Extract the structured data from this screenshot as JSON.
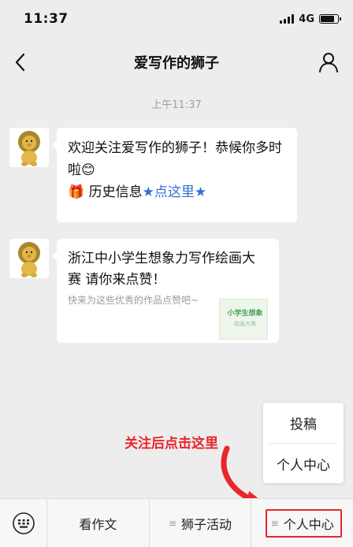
{
  "status": {
    "time": "11:37",
    "network": "4G"
  },
  "nav": {
    "title": "爱写作的狮子"
  },
  "chat": {
    "timestamp": "上午11:37",
    "msg1": {
      "text": "欢迎关注爱写作的狮子！恭候你多时啦",
      "emoji": "😊",
      "gift_icon": "🎁",
      "history_label": "历史信息",
      "link_text": "点这里",
      "star": "★"
    },
    "msg2": {
      "title": "浙江中小学生想象力写作绘画大赛 请你来点赞！",
      "desc": "快来为这些优秀的作品点赞吧~",
      "thumb_line1": "小学生想象",
      "thumb_line2": "绘画大赛"
    }
  },
  "popup": {
    "items": [
      "投稿",
      "个人中心"
    ]
  },
  "annotation": {
    "text": "关注后点击这里",
    "color": "#e8262b"
  },
  "bottom_menu": {
    "tabs": [
      "看作文",
      "狮子活动",
      "个人中心"
    ],
    "menu_glyph": "≡"
  },
  "colors": {
    "background": "#ededed",
    "bubble": "#ffffff",
    "link": "#2f6fd6",
    "accent_red": "#e8262b"
  }
}
